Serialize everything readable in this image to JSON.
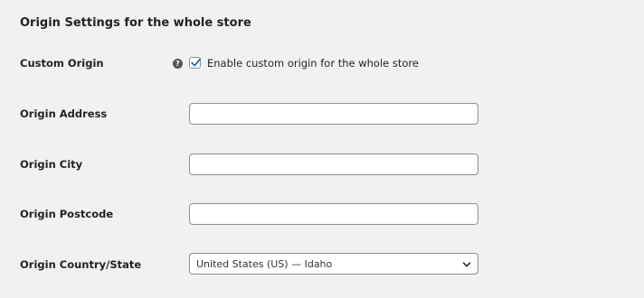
{
  "section": {
    "title": "Origin Settings for the whole store"
  },
  "custom_origin": {
    "label": "Custom Origin",
    "help_icon": "question-circle-icon",
    "checkbox_checked": true,
    "checkbox_label": "Enable custom origin for the whole store"
  },
  "address": {
    "label": "Origin Address",
    "value": ""
  },
  "city": {
    "label": "Origin City",
    "value": ""
  },
  "postcode": {
    "label": "Origin Postcode",
    "value": ""
  },
  "country": {
    "label": "Origin Country/State",
    "selected": "United States (US) — Idaho",
    "icon": "chevron-down-icon"
  },
  "colors": {
    "checkmark": "#2271b1",
    "background": "#f1f1f1",
    "border": "#8c8f94"
  }
}
